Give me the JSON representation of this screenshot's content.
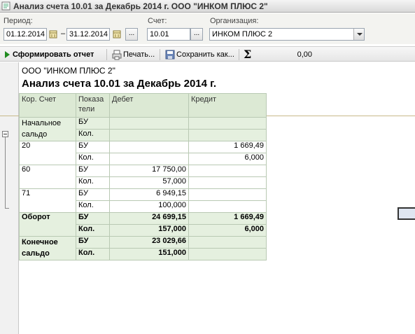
{
  "window": {
    "title": "Анализ счета 10.01 за Декабрь 2014 г. ООО \"ИНКОМ ПЛЮС 2\""
  },
  "params": {
    "period_label": "Период:",
    "date_from": "01.12.2014",
    "date_sep": "–",
    "date_to": "31.12.2014",
    "dots": "...",
    "account_label": "Счет:",
    "account_value": "10.01",
    "org_label": "Организация:",
    "org_value": "ИНКОМ ПЛЮС 2"
  },
  "toolbar": {
    "generate": "Сформировать отчет",
    "print": "Печать...",
    "save": "Сохранить как...",
    "sum_symbol": "Σ",
    "sum_value": "0,00"
  },
  "report": {
    "org": "ООО \"ИНКОМ ПЛЮС 2\"",
    "title": "Анализ счета 10.01 за Декабрь 2014 г.",
    "headers": [
      "Кор. Счет",
      "Показа тели",
      "Дебет",
      "Кредит"
    ],
    "rows": [
      [
        "Начальное сальдо",
        "БУ",
        "",
        ""
      ],
      [
        "",
        "Кол.",
        "",
        ""
      ],
      [
        "20",
        "БУ",
        "",
        "1 669,49"
      ],
      [
        "",
        "Кол.",
        "",
        "6,000"
      ],
      [
        "60",
        "БУ",
        "17 750,00",
        ""
      ],
      [
        "",
        "Кол.",
        "57,000",
        ""
      ],
      [
        "71",
        "БУ",
        "6 949,15",
        ""
      ],
      [
        "",
        "Кол.",
        "100,000",
        ""
      ],
      [
        "Оборот",
        "БУ",
        "24 699,15",
        "1 669,49"
      ],
      [
        "",
        "Кол.",
        "157,000",
        "6,000"
      ],
      [
        "Конечное сальдо",
        "БУ",
        "23 029,66",
        ""
      ],
      [
        "",
        "Кол.",
        "151,000",
        ""
      ]
    ]
  }
}
